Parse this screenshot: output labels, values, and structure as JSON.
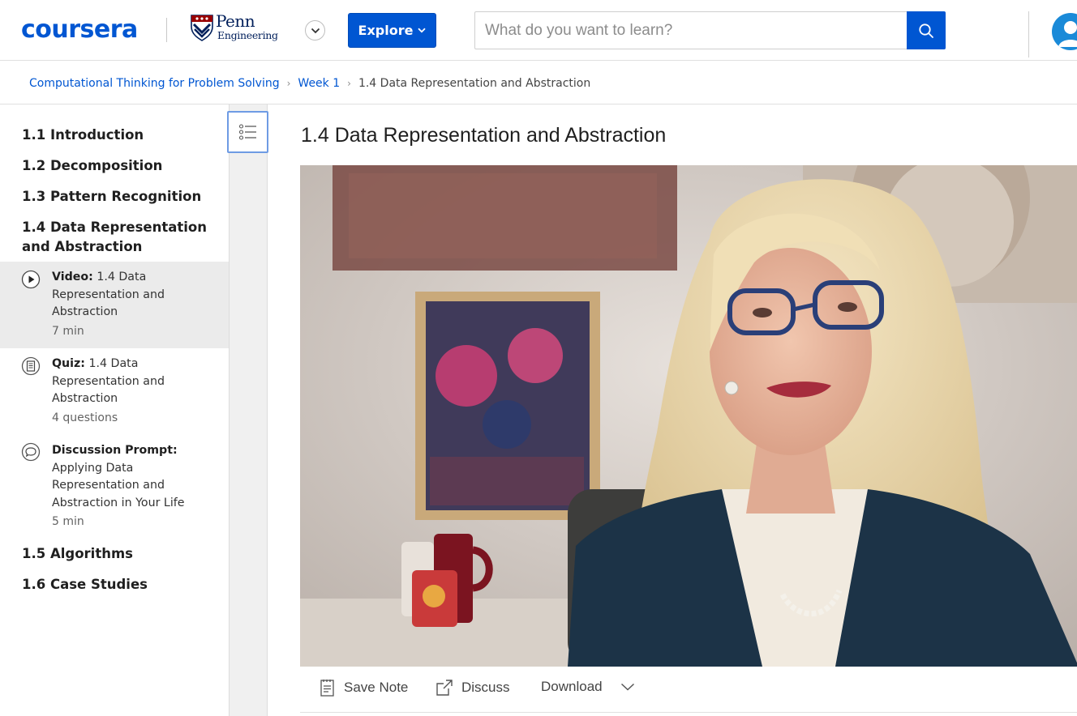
{
  "colors": {
    "brand": "#0056d2",
    "penn_navy": "#011f5b",
    "active_bg": "#ebebeb"
  },
  "header": {
    "logo_text": "coursera",
    "partner_logo": {
      "name": "Penn",
      "sub": "Engineering"
    },
    "explore_label": "Explore",
    "search_placeholder": "What do you want to learn?"
  },
  "breadcrumb": {
    "course": "Computational Thinking for Problem Solving",
    "week": "Week 1",
    "current": "1.4 Data Representation and Abstraction"
  },
  "sidebar": {
    "lessons": [
      {
        "label": "1.1 Introduction"
      },
      {
        "label": "1.2 Decomposition"
      },
      {
        "label": "1.3 Pattern Recognition"
      },
      {
        "label": "1.4 Data Representation and Abstraction"
      },
      {
        "label": "1.5 Algorithms"
      },
      {
        "label": "1.6 Case Studies"
      }
    ],
    "items": [
      {
        "type_label": "Video:",
        "title": "1.4 Data Representation and Abstraction",
        "meta": "7 min",
        "icon": "play-circle-icon",
        "active": true
      },
      {
        "type_label": "Quiz:",
        "title": "1.4 Data Representation and Abstraction",
        "meta": "4 questions",
        "icon": "quiz-icon",
        "active": false
      },
      {
        "type_label": "Discussion Prompt:",
        "title": "Applying Data Representation and Abstraction in Your Life",
        "meta": "5 min",
        "icon": "discussion-icon",
        "active": false
      }
    ]
  },
  "main": {
    "title": "1.4 Data Representation and Abstraction",
    "actions": {
      "save_note": "Save Note",
      "discuss": "Discuss",
      "download": "Download"
    }
  }
}
